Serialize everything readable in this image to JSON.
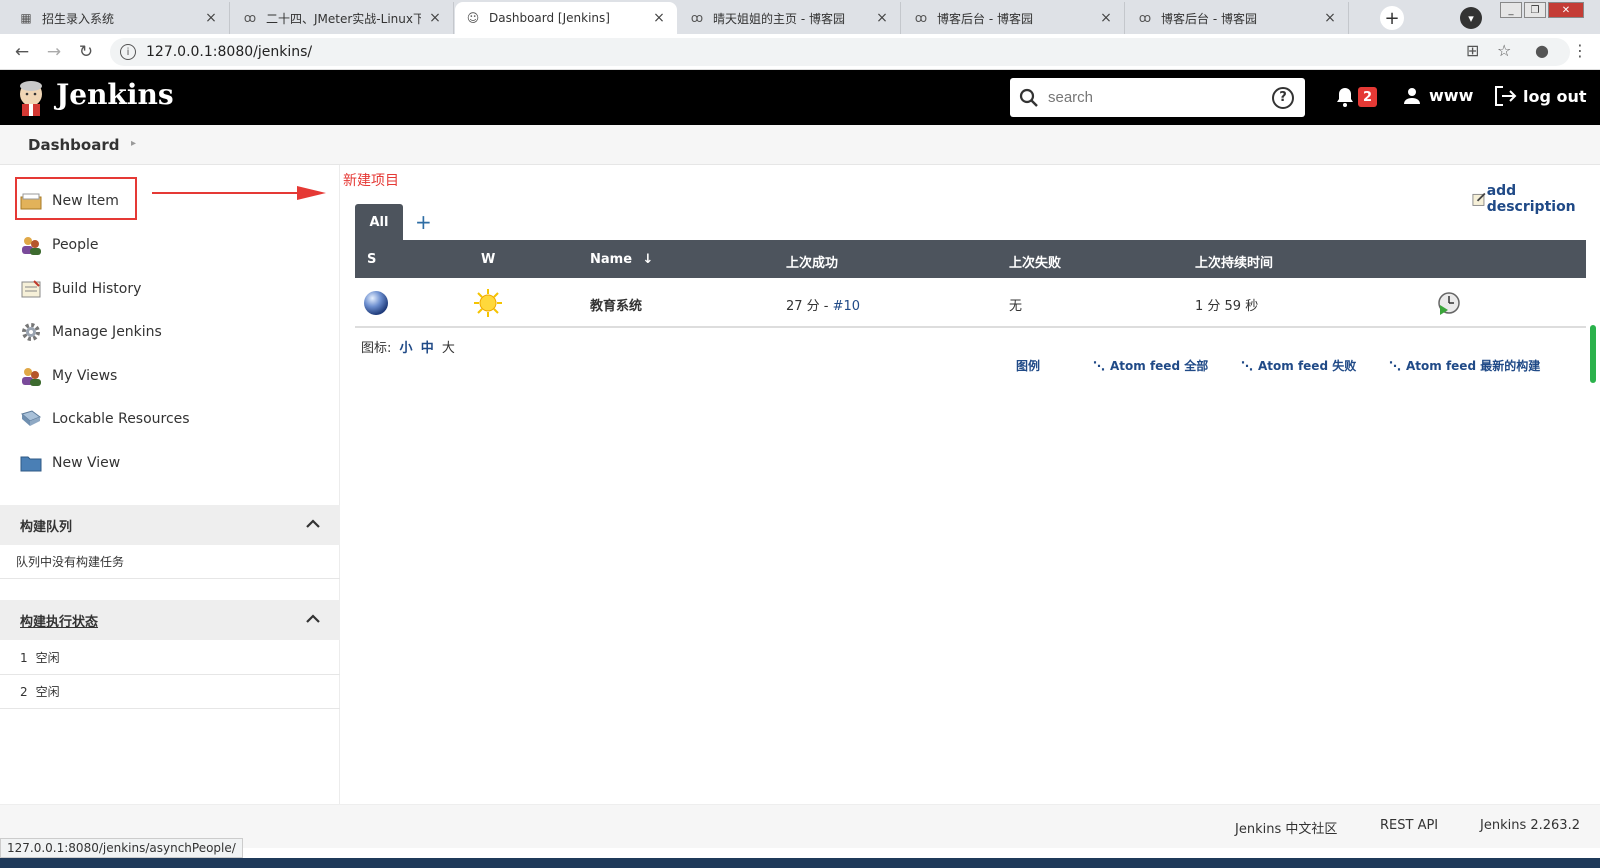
{
  "browser": {
    "tabs": [
      {
        "title": "招生录入系统",
        "active": false
      },
      {
        "title": "二十四、JMeter实战-Linux下",
        "active": false
      },
      {
        "title": "Dashboard [Jenkins]",
        "active": true
      },
      {
        "title": "晴天姐姐的主页 - 博客园",
        "active": false
      },
      {
        "title": "博客后台 - 博客园",
        "active": false
      },
      {
        "title": "博客后台 - 博客园",
        "active": false
      }
    ],
    "url": "127.0.0.1:8080/jenkins/"
  },
  "header": {
    "brand": "Jenkins",
    "search_placeholder": "search",
    "help_symbol": "?",
    "notifications_count": "2",
    "username": "www",
    "logout_label": "log out"
  },
  "breadcrumb": {
    "label": "Dashboard"
  },
  "sidebar": {
    "tasks": [
      {
        "label": "New Item"
      },
      {
        "label": "People"
      },
      {
        "label": "Build History"
      },
      {
        "label": "Manage Jenkins"
      },
      {
        "label": "My Views"
      },
      {
        "label": "Lockable Resources"
      },
      {
        "label": "New View"
      }
    ],
    "build_queue": {
      "title": "构建队列",
      "empty_text": "队列中没有构建任务"
    },
    "executors": {
      "title": "构建执行状态",
      "rows": [
        {
          "num": "1",
          "status": "空闲"
        },
        {
          "num": "2",
          "status": "空闲"
        }
      ]
    }
  },
  "annotation": {
    "label": "新建项目",
    "color": "#e53935"
  },
  "main": {
    "add_description": "add description",
    "view_tab": "All",
    "add_view_symbol": "+",
    "table": {
      "headers": {
        "s": "S",
        "w": "W",
        "name": "Name",
        "sort": "↓",
        "last_success": "上次成功",
        "last_failure": "上次失败",
        "last_duration": "上次持续时间"
      },
      "rows": [
        {
          "name": "教育系统",
          "last_success_time": "27 分 - ",
          "last_success_build": "#10",
          "last_failure": "无",
          "last_duration": "1 分 59 秒",
          "status": "blue",
          "weather": "sunny"
        }
      ]
    },
    "icon_size": {
      "label": "图标:",
      "small": "小",
      "medium": "中",
      "large": "大"
    },
    "feeds": {
      "legend": "图例",
      "all": "Atom feed 全部",
      "failed": "Atom feed 失败",
      "latest": "Atom feed 最新的构建"
    }
  },
  "footer": {
    "community": "Jenkins 中文社区",
    "rest_api": "REST API",
    "version": "Jenkins 2.263.2"
  },
  "statusbar": {
    "url": "127.0.0.1:8080/jenkins/asynchPeople/"
  },
  "colors": {
    "header_bg": "#000000",
    "table_head_bg": "#4d545d",
    "link": "#204a87",
    "badge": "#e53935"
  }
}
